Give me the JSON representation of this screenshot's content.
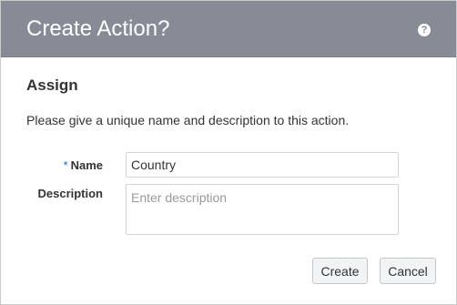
{
  "dialog": {
    "title": "Create Action?",
    "help_icon": "?",
    "section_title": "Assign",
    "instructions": "Please give a unique name and description to this action.",
    "fields": {
      "name": {
        "required_marker": "*",
        "label": "Name",
        "value": "Country"
      },
      "description": {
        "label": "Description",
        "value": "",
        "placeholder": "Enter description"
      }
    },
    "buttons": {
      "create": "Create",
      "cancel": "Cancel"
    }
  }
}
